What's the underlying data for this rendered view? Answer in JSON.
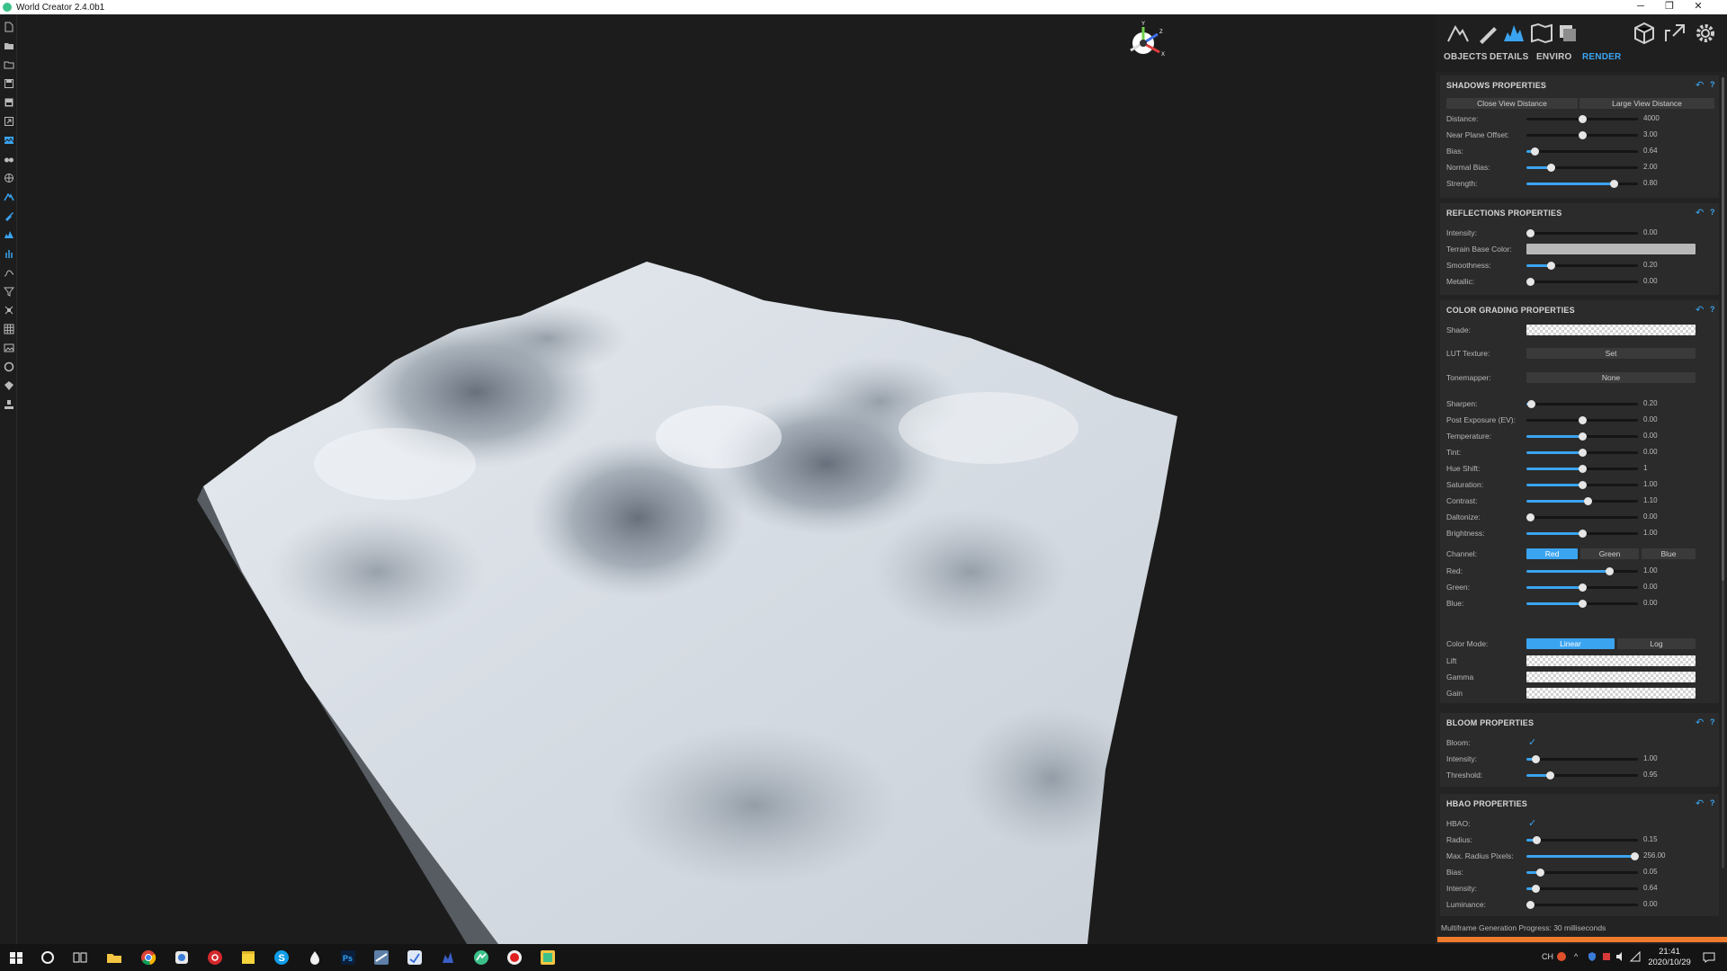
{
  "window": {
    "title": "World Creator 2.4.0b1",
    "controls": [
      "─",
      "❐",
      "✕"
    ]
  },
  "left_toolbar": [
    "new-file-icon",
    "open-folder-icon",
    "open-project-icon",
    "save-icon",
    "save-as-icon",
    "export-icon",
    "terrain-map-icon",
    "binoculars-icon",
    "globe-icon",
    "sculpt-icon",
    "paint-brush-icon",
    "biome-icon",
    "vegetation-icon",
    "river-icon",
    "filter-icon",
    "transform-icon",
    "grid-icon",
    "image-icon",
    "circle-icon",
    "gem-icon",
    "stamp-icon"
  ],
  "top_icons": [
    "terrain-icon",
    "brush-icon",
    "biomes-icon",
    "map-icon",
    "layers-icon",
    "cube-icon",
    "share-icon",
    "settings-icon"
  ],
  "tabs": {
    "objects": "OBJECTS",
    "details": "DETAILS",
    "enviro": "ENVIRO",
    "render": "RENDER"
  },
  "shadows": {
    "title": "SHADOWS PROPERTIES",
    "close_view": "Close View Distance",
    "large_view": "Large View Distance",
    "rows": [
      {
        "label": "Distance:",
        "value": "4000",
        "frac": 0.5,
        "fill": false
      },
      {
        "label": "Near Plane Offset:",
        "value": "3.00",
        "frac": 0.5,
        "fill": false
      },
      {
        "label": "Bias:",
        "value": "0.64",
        "frac": 0.07,
        "fill": true
      },
      {
        "label": "Normal Bias:",
        "value": "2.00",
        "frac": 0.22,
        "fill": true
      },
      {
        "label": "Strength:",
        "value": "0.80",
        "frac": 0.78,
        "fill": true
      }
    ]
  },
  "reflections": {
    "title": "REFLECTIONS PROPERTIES",
    "intensity": {
      "label": "Intensity:",
      "value": "0.00",
      "frac": 0.03
    },
    "terrain_base_color": {
      "label": "Terrain Base Color:",
      "color": "#b8b8b8"
    },
    "smoothness": {
      "label": "Smoothness:",
      "value": "0.20",
      "frac": 0.22
    },
    "metallic": {
      "label": "Metallic:",
      "value": "0.00",
      "frac": 0.03
    }
  },
  "color_grading": {
    "title": "COLOR GRADING PROPERTIES",
    "shade": "Shade:",
    "lut_label": "LUT Texture:",
    "lut_button": "Set",
    "tonemapper_label": "Tonemapper:",
    "tonemapper_value": "None",
    "rows": [
      {
        "label": "Sharpen:",
        "value": "0.20",
        "frac": 0.04,
        "fill": true
      },
      {
        "label": "Post Exposure (EV):",
        "value": "0.00",
        "frac": 0.5,
        "fill": false
      },
      {
        "label": "Temperature:",
        "value": "0.00",
        "frac": 0.5,
        "fill": true
      },
      {
        "label": "Tint:",
        "value": "0.00",
        "frac": 0.5,
        "fill": true
      },
      {
        "label": "Hue Shift:",
        "value": "1",
        "frac": 0.5,
        "fill": true
      },
      {
        "label": "Saturation:",
        "value": "1.00",
        "frac": 0.5,
        "fill": true
      },
      {
        "label": "Contrast:",
        "value": "1.10",
        "frac": 0.55,
        "fill": true
      },
      {
        "label": "Daltonize:",
        "value": "0.00",
        "frac": 0.03,
        "fill": true
      },
      {
        "label": "Brightness:",
        "value": "1.00",
        "frac": 0.5,
        "fill": true
      }
    ],
    "channel_label": "Channel:",
    "channels": [
      "Red",
      "Green",
      "Blue"
    ],
    "active_channel": "Red",
    "channel_rows": [
      {
        "label": "Red:",
        "value": "1.00",
        "frac": 0.74,
        "fill": true
      },
      {
        "label": "Green:",
        "value": "0.00",
        "frac": 0.5,
        "fill": true
      },
      {
        "label": "Blue:",
        "value": "0.00",
        "frac": 0.5,
        "fill": true
      }
    ],
    "color_mode_label": "Color Mode:",
    "color_modes": [
      "Linear",
      "Log"
    ],
    "active_mode": "Linear",
    "lift": "Lift",
    "gamma": "Gamma",
    "gain": "Gain"
  },
  "bloom": {
    "title": "BLOOM PROPERTIES",
    "bloom_label": "Bloom:",
    "bloom_checked": true,
    "rows": [
      {
        "label": "Intensity:",
        "value": "1.00",
        "frac": 0.08,
        "fill": true
      },
      {
        "label": "Threshold:",
        "value": "0.95",
        "frac": 0.21,
        "fill": true
      }
    ]
  },
  "hbao": {
    "title": "HBAO PROPERTIES",
    "hbao_label": "HBAO:",
    "hbao_checked": true,
    "rows": [
      {
        "label": "Radius:",
        "value": "0.15",
        "frac": 0.09,
        "fill": true
      },
      {
        "label": "Max. Radius Pixels:",
        "value": "256.00",
        "frac": 0.97,
        "fill": true
      },
      {
        "label": "Bias:",
        "value": "0.05",
        "frac": 0.12,
        "fill": true
      },
      {
        "label": "Intensity:",
        "value": "0.64",
        "frac": 0.08,
        "fill": true
      },
      {
        "label": "Luminance:",
        "value": "0.00",
        "frac": 0.03,
        "fill": true
      }
    ]
  },
  "progress": {
    "label": "Multiframe Generation Progress: 30 milliseconds",
    "fraction": 1.0
  },
  "taskbar": {
    "apps": [
      "windows-start-icon",
      "cortana-icon",
      "task-view-icon",
      "file-explorer-icon",
      "chrome-icon",
      "app-icon",
      "netease-icon",
      "sticky-notes-icon",
      "skype-icon",
      "ink-drop-icon",
      "photoshop-icon",
      "steam-icon",
      "app-icon-2",
      "app-icon-3",
      "world-creator-icon",
      "recorder-icon",
      "app-icon-4"
    ],
    "lang": "CH",
    "time": "21:41",
    "date": "2020/10/29"
  },
  "colors": {
    "accent": "#3ba4f0",
    "progress": "#ee7a2c"
  }
}
